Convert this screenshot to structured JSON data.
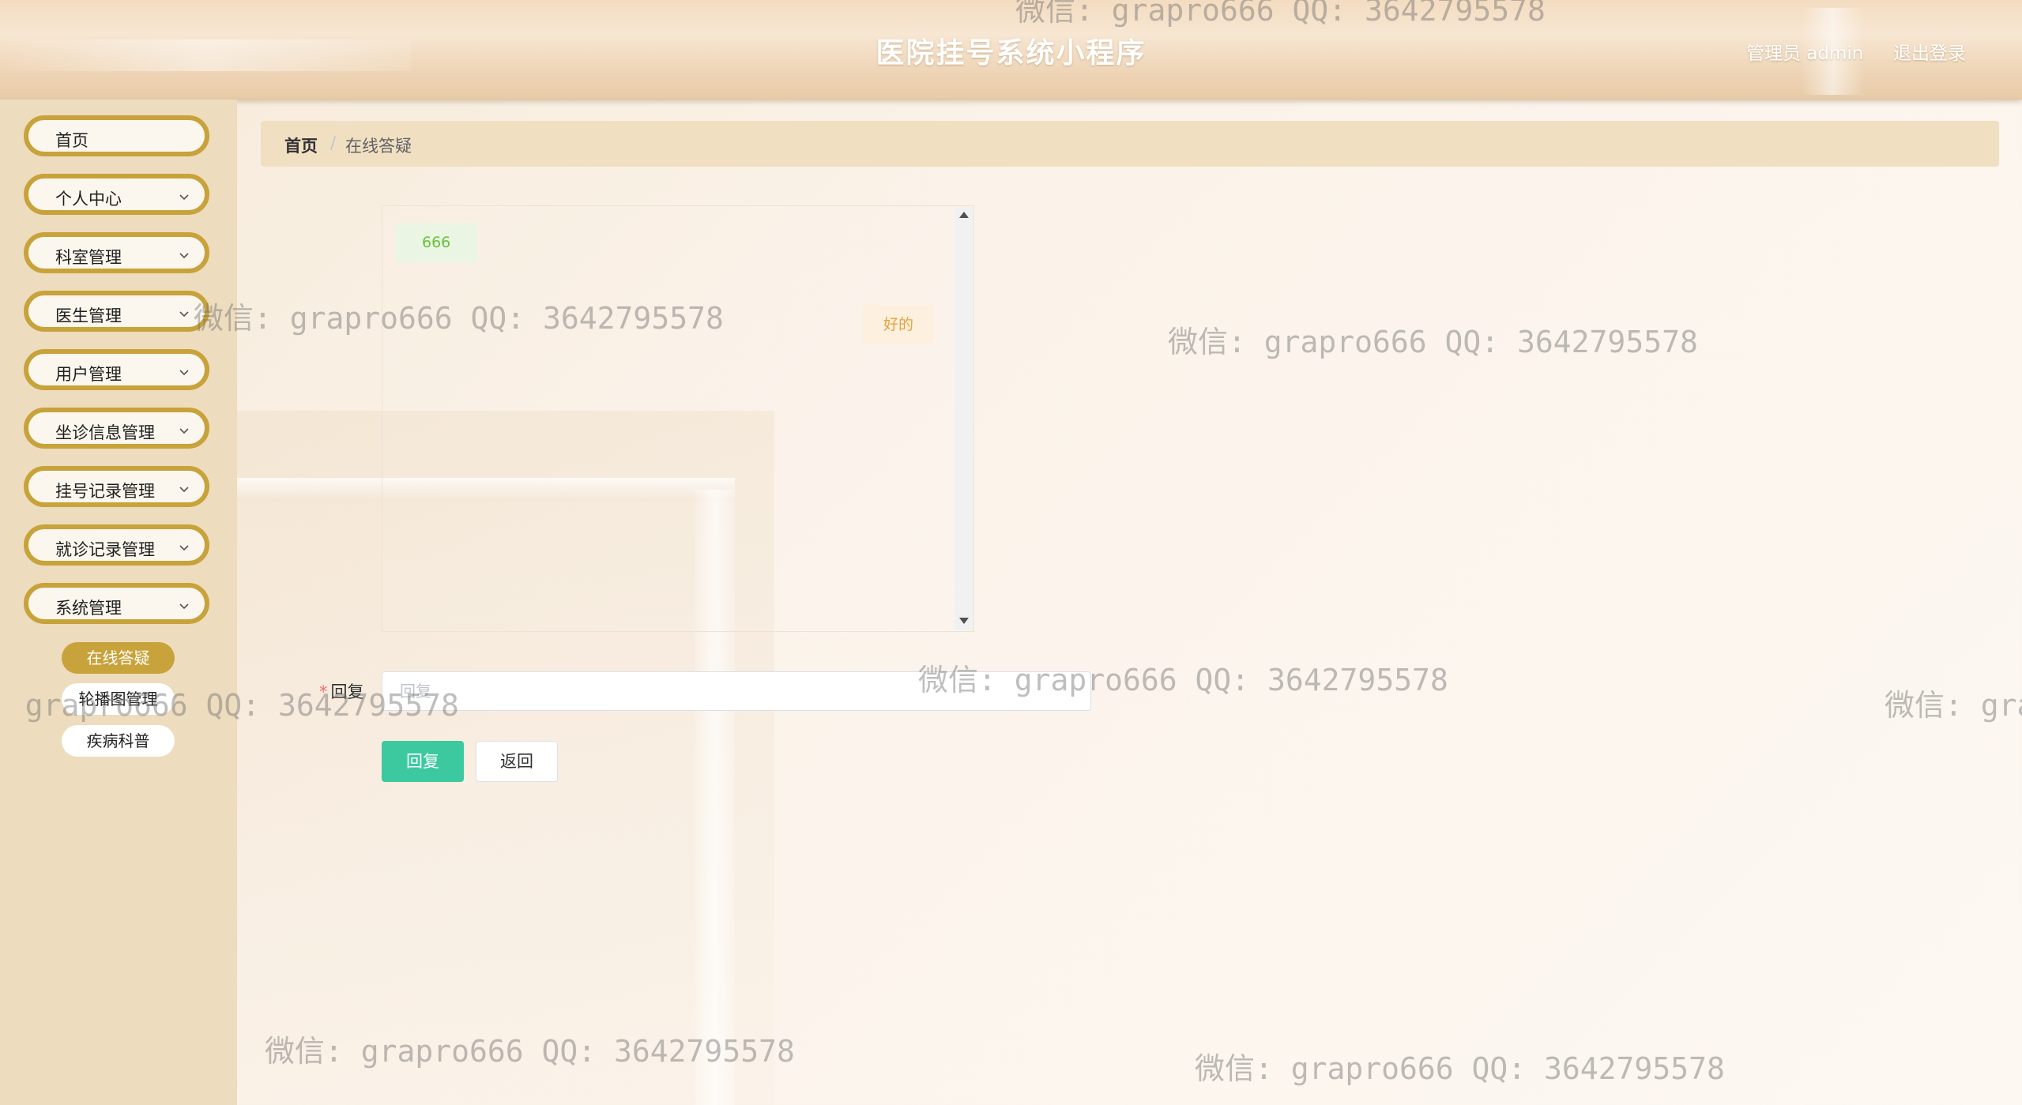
{
  "header": {
    "title": "医院挂号系统小程序",
    "admin_label": "管理员 admin",
    "logout_label": "退出登录"
  },
  "sidebar": {
    "items": [
      {
        "label": "首页",
        "has_chevron": false
      },
      {
        "label": "个人中心",
        "has_chevron": true
      },
      {
        "label": "科室管理",
        "has_chevron": true
      },
      {
        "label": "医生管理",
        "has_chevron": true
      },
      {
        "label": "用户管理",
        "has_chevron": true
      },
      {
        "label": "坐诊信息管理",
        "has_chevron": true
      },
      {
        "label": "挂号记录管理",
        "has_chevron": true
      },
      {
        "label": "就诊记录管理",
        "has_chevron": true
      },
      {
        "label": "系统管理",
        "has_chevron": true
      }
    ],
    "sub_items": [
      {
        "label": "在线答疑",
        "active": true
      },
      {
        "label": "轮播图管理",
        "active": false
      },
      {
        "label": "疾病科普",
        "active": false
      }
    ]
  },
  "breadcrumb": {
    "home": "首页",
    "separator": "/",
    "current": "在线答疑"
  },
  "chat": {
    "messages": [
      {
        "side": "left",
        "text": "666"
      },
      {
        "side": "right",
        "text": "好的"
      }
    ]
  },
  "form": {
    "required_mark": "*",
    "reply_label": "回复",
    "reply_placeholder": "回复",
    "reply_value": ""
  },
  "buttons": {
    "reply_label": "回复",
    "back_label": "返回"
  },
  "watermark_text": "微信: grapro666 QQ: 3642795578",
  "colors": {
    "accent_gold": "#c8a23a",
    "primary_green": "#3cc9a0",
    "sidebar_bg": "#eddcbd"
  }
}
